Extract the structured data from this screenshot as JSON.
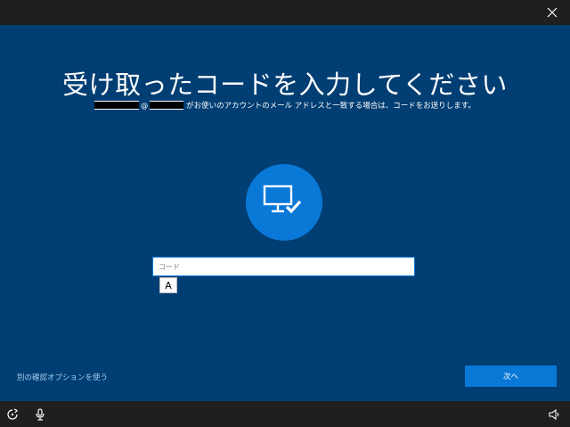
{
  "window": {
    "close_icon": "close-icon"
  },
  "page": {
    "title": "受け取ったコードを入力してください",
    "subtitle_at": "@",
    "subtitle_text": "がお使いのアカウントのメール アドレスと一致する場合は、コードをお送りします。",
    "center_icon": "monitor-check-icon"
  },
  "form": {
    "code_placeholder": "コード",
    "code_value": "",
    "ime_mode": "A"
  },
  "footer": {
    "alt_option_link": "別の確認オプションを使う",
    "next_button": "次へ"
  },
  "taskbar": {
    "left_icons": [
      "ease-of-access-icon",
      "microphone-icon"
    ],
    "right_icons": [
      "volume-icon"
    ]
  },
  "colors": {
    "background": "#003e73",
    "accent": "#0a78d7",
    "bar": "#1f1f1f",
    "link": "#a9d0f5"
  }
}
